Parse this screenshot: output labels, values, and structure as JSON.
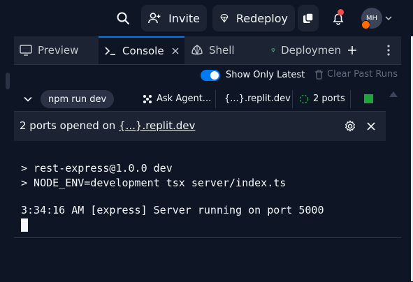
{
  "header": {
    "invite_label": "Invite",
    "redeploy_label": "Redeploy",
    "avatar_initials": "MH"
  },
  "tabs": [
    {
      "label": "Preview",
      "icon": "preview-icon"
    },
    {
      "label": "Console",
      "icon": "console-icon",
      "active": true
    },
    {
      "label": "Shell",
      "icon": "shell-icon"
    },
    {
      "label": "Deploymen",
      "icon": "deployments-icon"
    }
  ],
  "toolbar": {
    "show_only_latest_label": "Show Only Latest",
    "show_only_latest_enabled": true,
    "clear_past_runs_label": "Clear Past Runs"
  },
  "run_bar": {
    "command_label": "npm run dev",
    "ask_agent_label": "Ask Agent...",
    "domain_label": "{...}.replit.dev",
    "ports_label": "2 ports"
  },
  "notice": {
    "text_prefix": "2 ports opened on ",
    "link_text": "{...}.replit.dev"
  },
  "console": {
    "lines": [
      "> rest-express@1.0.0 dev",
      "> NODE_ENV=development tsx server/index.ts",
      "3:34:16 AM [express] Server running on port 5000"
    ]
  },
  "colors": {
    "accent": "#0079f2",
    "running_green": "#1fa33d",
    "notification_red": "#f04d4d",
    "avatar_badge": "#ff6b00"
  }
}
